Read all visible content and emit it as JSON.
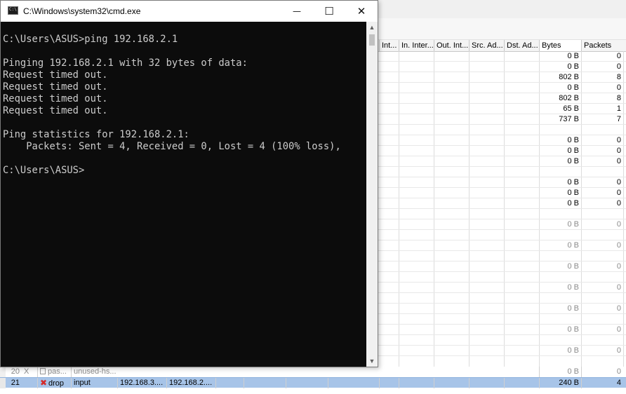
{
  "bg_table": {
    "columns": [
      "Int...",
      "In. Inter...",
      "Out. Int...",
      "Src. Ad...",
      "Dst. Ad...",
      "Bytes",
      "Packets"
    ],
    "rows": [
      {
        "bytes": "0 B",
        "packets": "0",
        "disabled": false
      },
      {
        "bytes": "0 B",
        "packets": "0",
        "disabled": false
      },
      {
        "bytes": "802 B",
        "packets": "8",
        "disabled": false
      },
      {
        "bytes": "0 B",
        "packets": "0",
        "disabled": false
      },
      {
        "bytes": "802 B",
        "packets": "8",
        "disabled": false
      },
      {
        "bytes": "65 B",
        "packets": "1",
        "disabled": false
      },
      {
        "bytes": "737 B",
        "packets": "7",
        "disabled": false
      },
      {
        "bytes": "",
        "packets": "",
        "disabled": false
      },
      {
        "bytes": "0 B",
        "packets": "0",
        "disabled": false
      },
      {
        "bytes": "0 B",
        "packets": "0",
        "disabled": false
      },
      {
        "bytes": "0 B",
        "packets": "0",
        "disabled": false
      },
      {
        "bytes": "",
        "packets": "",
        "disabled": false
      },
      {
        "bytes": "0 B",
        "packets": "0",
        "disabled": false
      },
      {
        "bytes": "0 B",
        "packets": "0",
        "disabled": false
      },
      {
        "bytes": "0 B",
        "packets": "0",
        "disabled": false
      },
      {
        "bytes": "",
        "packets": "",
        "disabled": false
      },
      {
        "bytes": "0 B",
        "packets": "0",
        "disabled": true
      },
      {
        "bytes": "",
        "packets": "",
        "disabled": false
      },
      {
        "bytes": "0 B",
        "packets": "0",
        "disabled": true
      },
      {
        "bytes": "",
        "packets": "",
        "disabled": false
      },
      {
        "bytes": "0 B",
        "packets": "0",
        "disabled": true
      },
      {
        "bytes": "",
        "packets": "",
        "disabled": false
      },
      {
        "bytes": "0 B",
        "packets": "0",
        "disabled": true
      },
      {
        "bytes": "",
        "packets": "",
        "disabled": false
      },
      {
        "bytes": "0 B",
        "packets": "0",
        "disabled": true
      },
      {
        "bytes": "",
        "packets": "",
        "disabled": false
      },
      {
        "bytes": "0 B",
        "packets": "0",
        "disabled": true
      },
      {
        "bytes": "",
        "packets": "",
        "disabled": false
      },
      {
        "bytes": "0 B",
        "packets": "0",
        "disabled": true
      }
    ],
    "rule20": {
      "num": "20",
      "flag": "X",
      "action": "pas...",
      "chain": "unused-hs...",
      "bytes": "0 B",
      "packets": "0"
    },
    "rule21": {
      "num": "21",
      "action": "drop",
      "chain": "input",
      "src": "192.168.3....",
      "dst": "192.168.2....",
      "bytes": "240 B",
      "packets": "4"
    }
  },
  "cmd": {
    "title": "C:\\Windows\\system32\\cmd.exe",
    "icon_label": "C:\\",
    "minimize_glyph": "—",
    "maximize_glyph": "☐",
    "close_glyph": "✕",
    "output": "\nC:\\Users\\ASUS>ping 192.168.2.1\n\nPinging 192.168.2.1 with 32 bytes of data:\nRequest timed out.\nRequest timed out.\nRequest timed out.\nRequest timed out.\n\nPing statistics for 192.168.2.1:\n    Packets: Sent = 4, Received = 0, Lost = 4 (100% loss),\n\nC:\\Users\\ASUS>",
    "scroll_up": "▲",
    "scroll_down": "▼"
  },
  "colors": {
    "console_bg": "#0c0c0c",
    "console_fg": "#cccccc",
    "selected_row": "#a7c4e8",
    "drop_icon": "#d42a2a"
  }
}
